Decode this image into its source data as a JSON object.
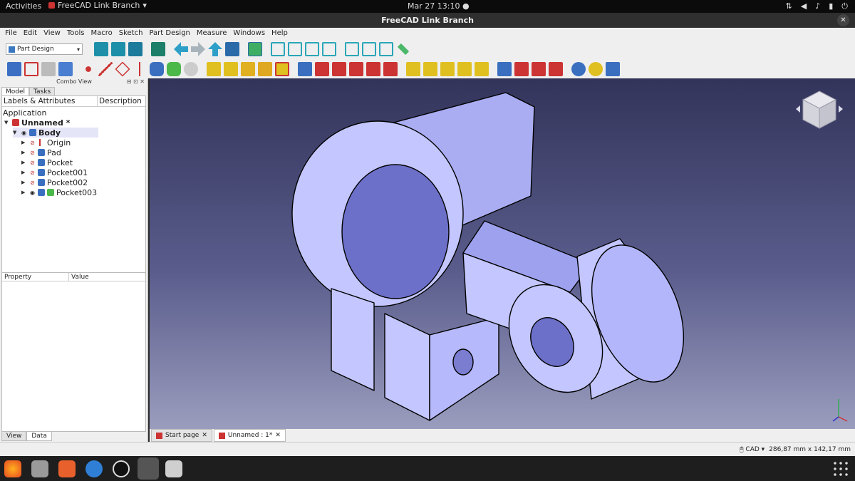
{
  "topbar": {
    "activities": "Activities",
    "app_name": "FreeCAD Link Branch",
    "clock": "Mar 27  13:10",
    "tray": [
      "network-icon",
      "volume-icon",
      "mic-icon",
      "battery-icon",
      "power-icon"
    ]
  },
  "window": {
    "title": "FreeCAD Link Branch",
    "close": "✕"
  },
  "menu": [
    "File",
    "Edit",
    "View",
    "Tools",
    "Macro",
    "Sketch",
    "Part Design",
    "Measure",
    "Windows",
    "Help"
  ],
  "workbench": {
    "selected": "Part Design"
  },
  "combo_view": {
    "title": "Combo View",
    "tabs": [
      "Model",
      "Tasks"
    ],
    "columns": [
      "Labels & Attributes",
      "Description"
    ],
    "root": "Application",
    "doc": "Unnamed *",
    "body": "Body",
    "children": [
      "Origin",
      "Pad",
      "Pocket",
      "Pocket001",
      "Pocket002",
      "Pocket003"
    ]
  },
  "property_view": {
    "columns": [
      "Property",
      "Value"
    ],
    "tabs": [
      "View",
      "Data"
    ]
  },
  "doc_tabs": [
    "Start page",
    "Unnamed : 1*"
  ],
  "status": {
    "nav": "CAD",
    "dims": "286,87 mm x 142,17 mm"
  },
  "colors": {
    "accent": "#2e7cc7",
    "part": "#b9bcff",
    "part_dark": "#8e91e8"
  }
}
